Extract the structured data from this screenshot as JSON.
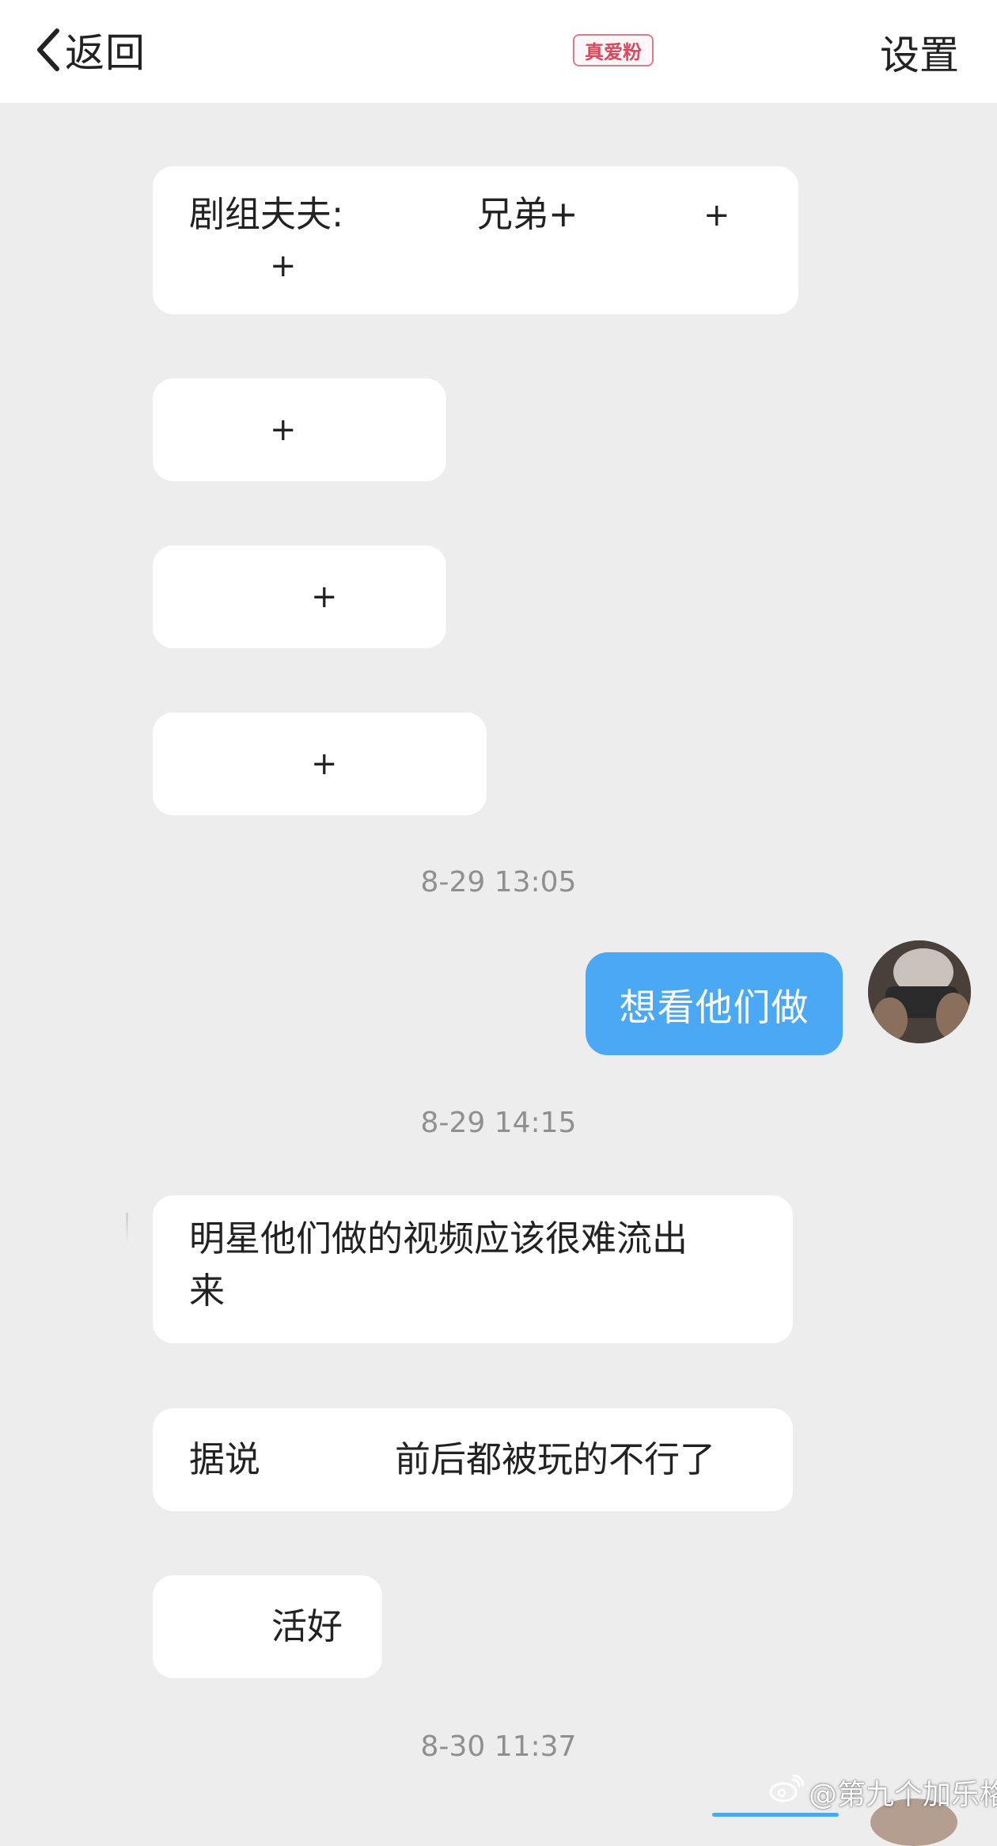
{
  "header": {
    "back_label": "返回",
    "badge": "真爱粉",
    "settings_label": "设置"
  },
  "messages": {
    "m1_prefix": "剧组夫夫:",
    "m1_word": "兄弟+",
    "plus": "+",
    "m_last": "活好",
    "m_rumor_prefix": "据说",
    "m_rumor_suffix": "前后都被玩的不行了",
    "m_video_line1": "明星他们做的视频应该很难流出",
    "m_video_line2": "来",
    "sent_text": "想看他们做"
  },
  "timestamps": [
    "8-29 13:05",
    "8-29 14:15",
    "8-30 11:37"
  ],
  "watermark": "@第九个加乐格",
  "colors": {
    "background": "#ededed",
    "bubble": "#ffffff",
    "sent_bubble": "#4aa8f5",
    "badge": "#d9485f",
    "timestamp": "#8f8f8f"
  },
  "icons": {
    "back": "chevron-left-icon",
    "watermark": "weibo-icon"
  }
}
